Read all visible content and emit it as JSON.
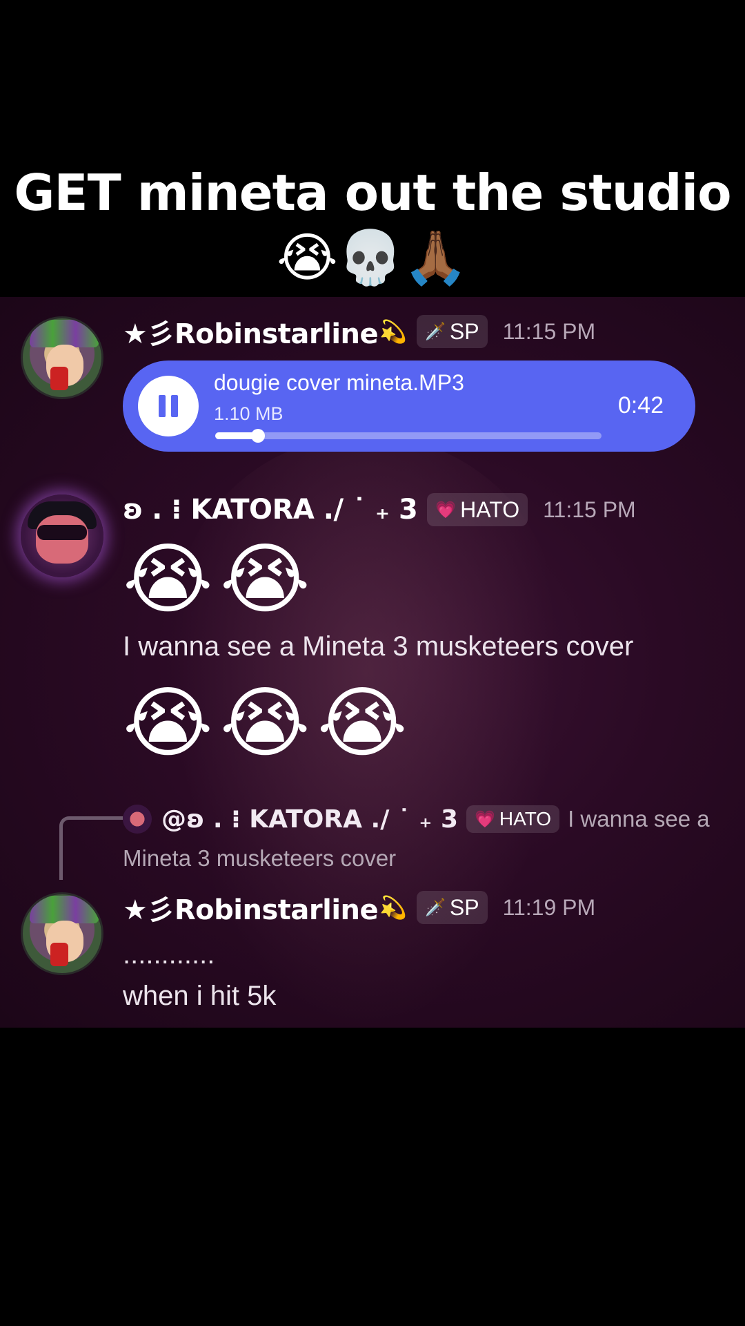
{
  "caption": {
    "title": "GET mineta out the studio",
    "emojis": "😭💀🙏🏾"
  },
  "messages": [
    {
      "author": "★彡Robinstarline",
      "author_deco": "💫",
      "badge_icon": "🗡️",
      "badge": "SP",
      "time": "11:15 PM",
      "attachment": {
        "file_name": "dougie cover mineta.MP3",
        "file_size": "1.10 MB",
        "duration": "0:42",
        "progress": 0.11
      }
    },
    {
      "author": "ʚ . ⁝ KATORA ./ ˙ ₊ 3",
      "badge_icon": "💗",
      "badge": "HATO",
      "time": "11:15 PM",
      "emojis_1": "😭😭",
      "text": "I wanna see a Mineta 3 musketeers cover",
      "emojis_2": "😭😭😭"
    },
    {
      "reply_to": {
        "mention": "@ʚ . ⁝ KATORA ./ ˙ ₊ 3",
        "badge_icon": "💗",
        "badge": "HATO",
        "text_start": "I wanna see a",
        "text_end": "Mineta 3 musketeers cover"
      },
      "author": "★彡Robinstarline",
      "author_deco": "💫",
      "badge_icon": "🗡️",
      "badge": "SP",
      "time": "11:19 PM",
      "line_1": "............",
      "line_2": "when i hit 5k"
    }
  ],
  "colors": {
    "audio_accent": "#5865f2",
    "chat_bg": "#2a0a24"
  }
}
